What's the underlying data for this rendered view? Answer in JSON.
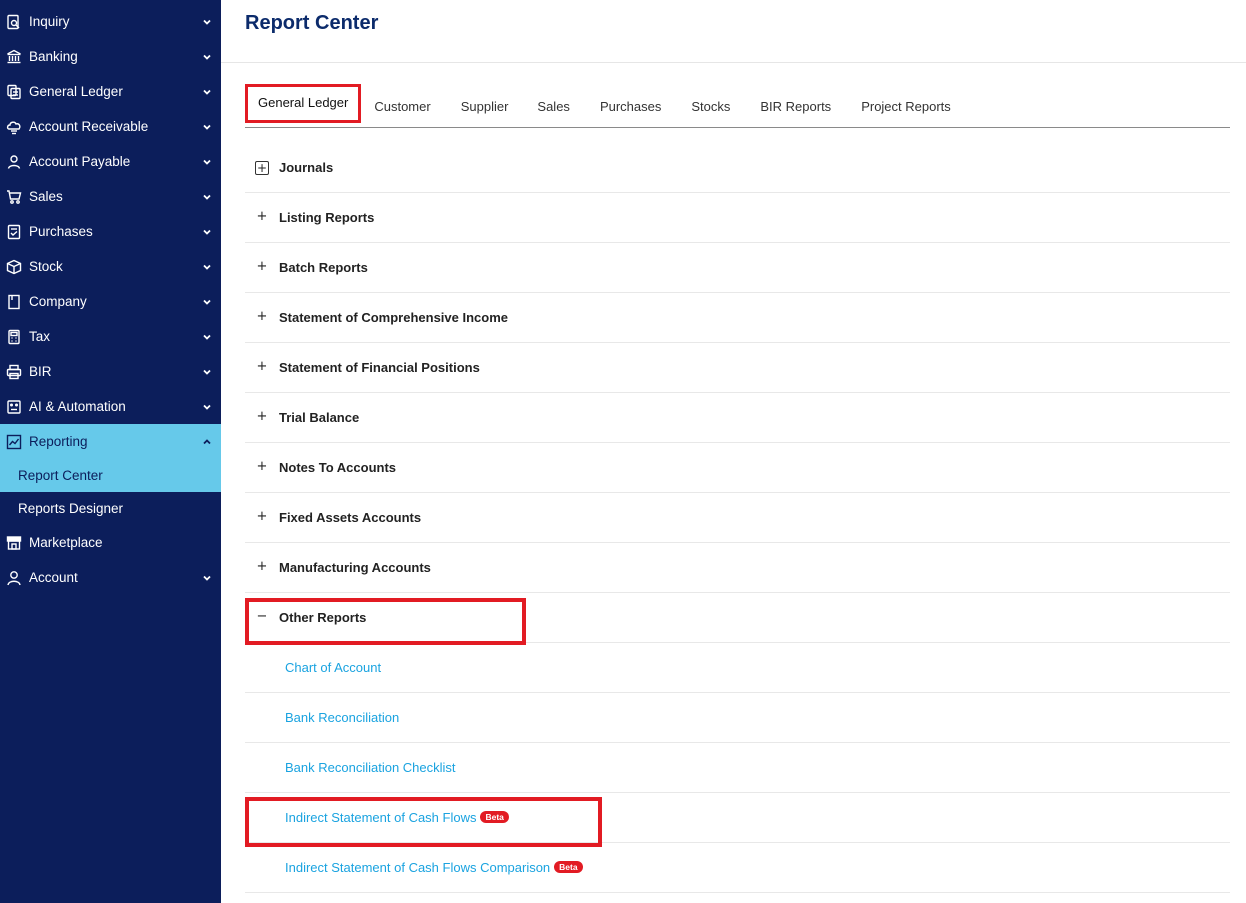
{
  "sidebar": {
    "items": [
      {
        "label": "Inquiry",
        "icon": "search-doc-icon",
        "chevron": "down"
      },
      {
        "label": "Banking",
        "icon": "bank-icon",
        "chevron": "down"
      },
      {
        "label": "General Ledger",
        "icon": "ledger-icon",
        "chevron": "down"
      },
      {
        "label": "Account Receivable",
        "icon": "receivable-icon",
        "chevron": "down"
      },
      {
        "label": "Account Payable",
        "icon": "user-payable-icon",
        "chevron": "down"
      },
      {
        "label": "Sales",
        "icon": "cart-icon",
        "chevron": "down"
      },
      {
        "label": "Purchases",
        "icon": "purchases-icon",
        "chevron": "down"
      },
      {
        "label": "Stock",
        "icon": "box-icon",
        "chevron": "down"
      },
      {
        "label": "Company",
        "icon": "building-icon",
        "chevron": "down"
      },
      {
        "label": "Tax",
        "icon": "calculator-icon",
        "chevron": "down"
      },
      {
        "label": "BIR",
        "icon": "printer-icon",
        "chevron": "down"
      },
      {
        "label": "AI & Automation",
        "icon": "robot-icon",
        "chevron": "down"
      },
      {
        "label": "Reporting",
        "icon": "chart-icon",
        "chevron": "up"
      }
    ],
    "reporting_sub": [
      {
        "label": "Report Center"
      },
      {
        "label": "Reports Designer"
      }
    ],
    "tail_items": [
      {
        "label": "Marketplace",
        "icon": "store-icon"
      },
      {
        "label": "Account",
        "icon": "user-icon",
        "chevron": "down"
      }
    ]
  },
  "main": {
    "title": "Report Center",
    "tabs": [
      {
        "label": "General Ledger"
      },
      {
        "label": "Customer"
      },
      {
        "label": "Supplier"
      },
      {
        "label": "Sales"
      },
      {
        "label": "Purchases"
      },
      {
        "label": "Stocks"
      },
      {
        "label": "BIR Reports"
      },
      {
        "label": "Project Reports"
      }
    ],
    "sections": [
      {
        "label": "Journals",
        "toggle": "+"
      },
      {
        "label": "Listing Reports",
        "toggle": "+"
      },
      {
        "label": "Batch Reports",
        "toggle": "+"
      },
      {
        "label": "Statement of Comprehensive Income",
        "toggle": "+"
      },
      {
        "label": "Statement of Financial Positions",
        "toggle": "+"
      },
      {
        "label": "Trial Balance",
        "toggle": "+"
      },
      {
        "label": "Notes To Accounts",
        "toggle": "+"
      },
      {
        "label": "Fixed Assets Accounts",
        "toggle": "+"
      },
      {
        "label": "Manufacturing Accounts",
        "toggle": "+"
      },
      {
        "label": "Other Reports",
        "toggle": "−"
      }
    ],
    "other_reports": [
      {
        "label": "Chart of Account",
        "badge": ""
      },
      {
        "label": "Bank Reconciliation",
        "badge": ""
      },
      {
        "label": "Bank Reconciliation Checklist",
        "badge": ""
      },
      {
        "label": "Indirect Statement of Cash Flows",
        "badge": "Beta"
      },
      {
        "label": "Indirect Statement of Cash Flows Comparison",
        "badge": "Beta"
      }
    ]
  },
  "colors": {
    "sidebar_bg": "#0c1e5b",
    "sidebar_active": "#66c9ea",
    "title": "#0c2b6b",
    "link": "#1aa3e0",
    "highlight": "#e21b23"
  }
}
